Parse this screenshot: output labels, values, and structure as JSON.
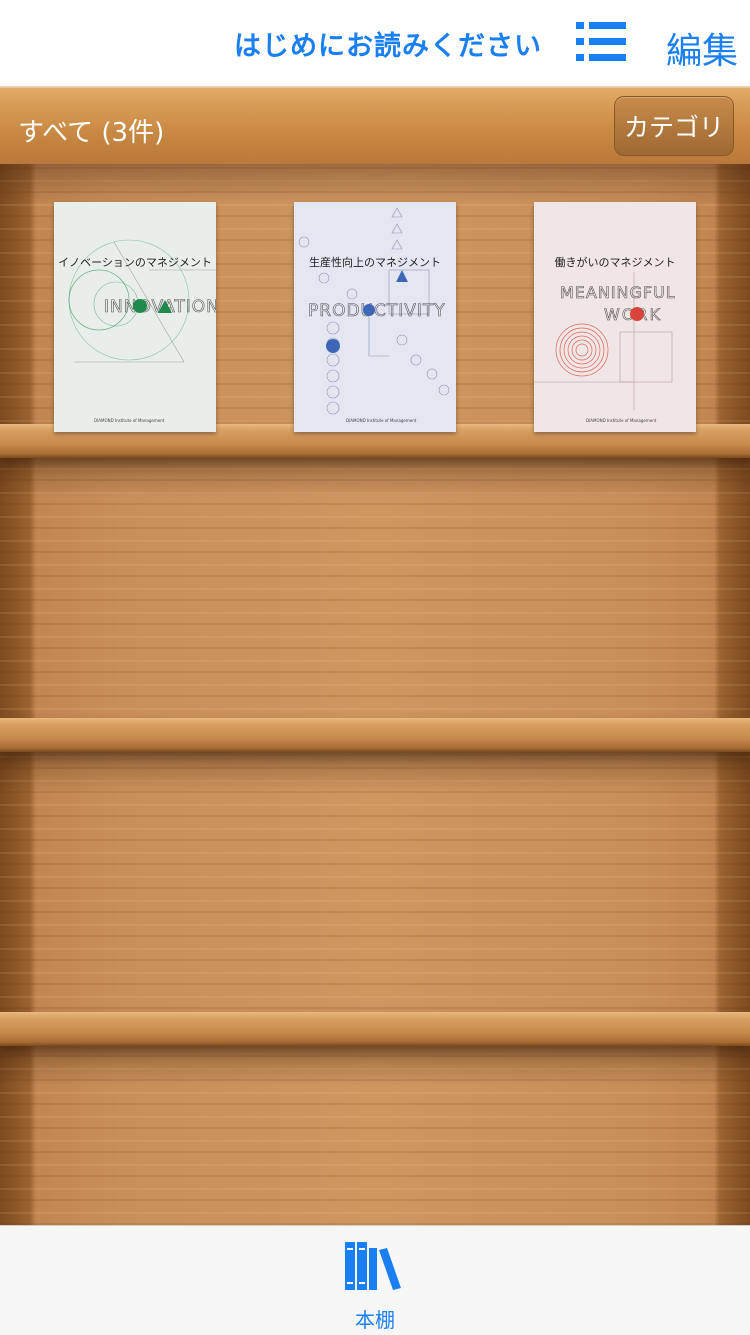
{
  "navbar": {
    "guide_link": "はじめにお読みください",
    "list_icon": "list-icon",
    "edit_label": "編集",
    "accent_color": "#1a7ff0"
  },
  "category_bar": {
    "title": "すべて (3件)",
    "category_button": "カテゴリ"
  },
  "books": [
    {
      "title": "イノベーションのマネジメント",
      "cover_word": "INNOVATION",
      "accent": "#1f8a4c",
      "background": "#e9eeea"
    },
    {
      "title": "生産性向上のマネジメント",
      "cover_word": "PRODUCTIVITY",
      "accent": "#3f67b8",
      "background": "#e4e7f2"
    },
    {
      "title": "働きがいのマネジメント",
      "cover_word": "MEANINGFUL WORK",
      "accent": "#d8453d",
      "background": "#f1e6e6"
    }
  ],
  "tabbar": {
    "tab_label": "本棚",
    "tab_icon": "bookshelf-icon"
  }
}
